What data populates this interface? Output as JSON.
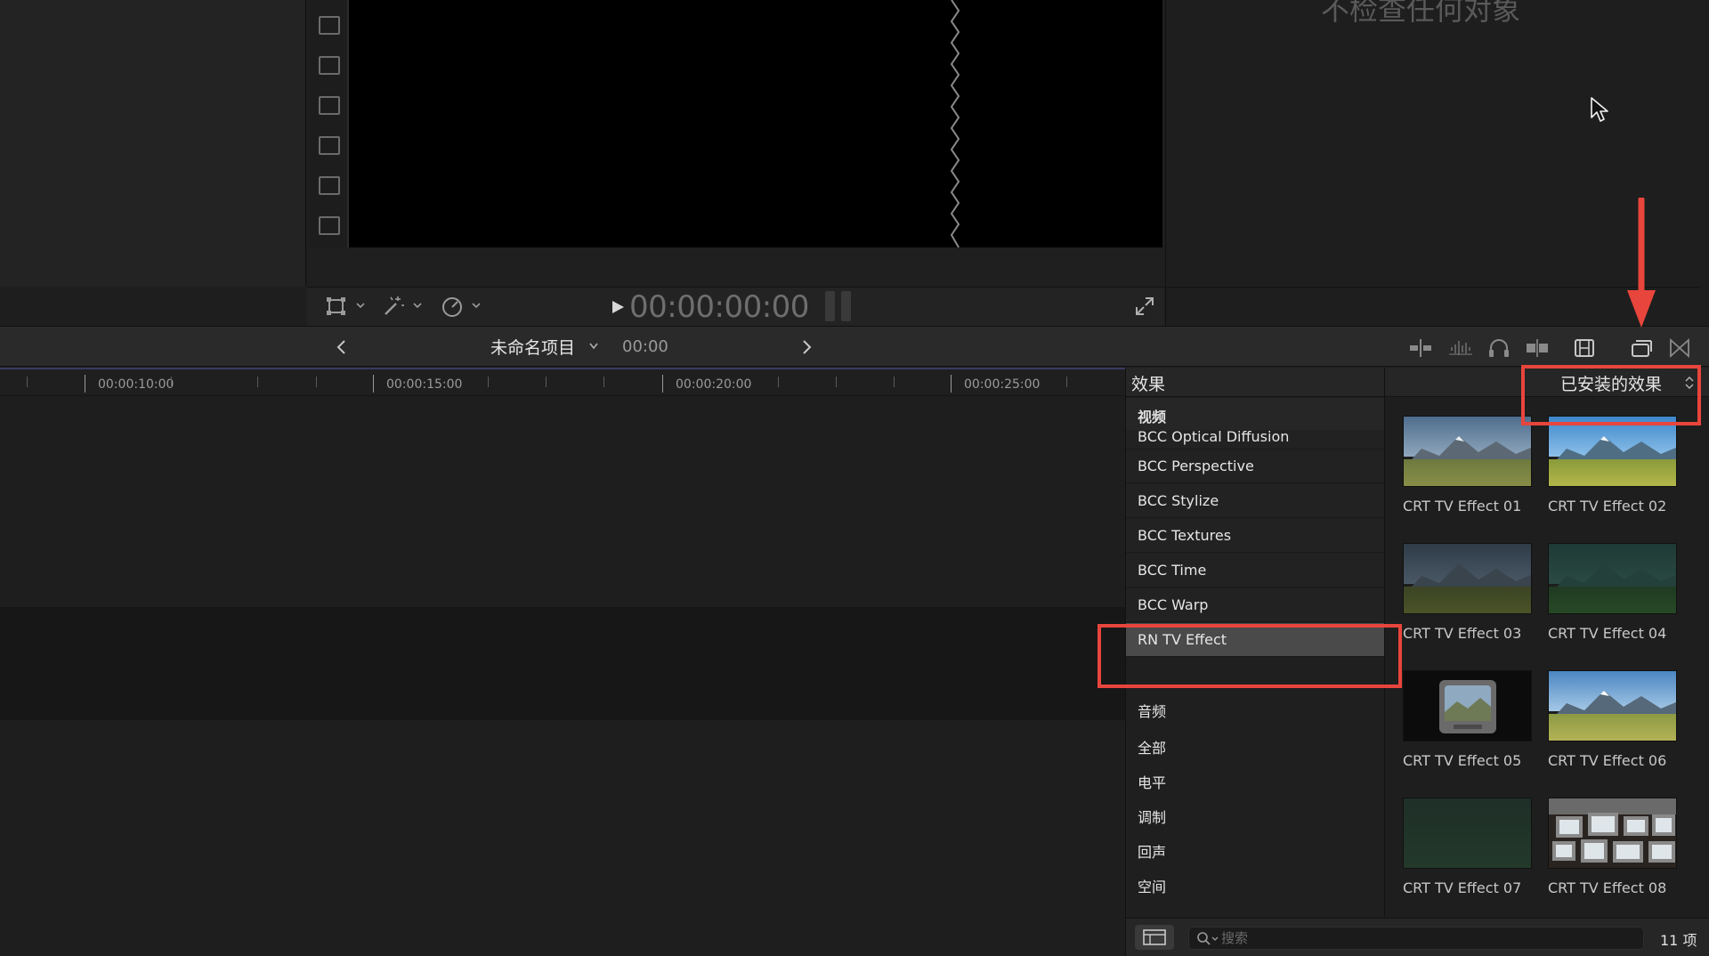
{
  "viewer": {
    "timecode": "00:00:00:00"
  },
  "inspector": {
    "message": "不检查任何对象"
  },
  "timeline_toolbar": {
    "project_name": "未命名项目",
    "timecode": "00:00"
  },
  "timeline_ruler": {
    "labels": [
      "00:00:10:00",
      "00:00:15:00",
      "00:00:20:00",
      "00:00:25:00"
    ]
  },
  "effects_browser": {
    "title": "效果",
    "filter": "已安装的效果",
    "sidebar": {
      "video_header": "视频",
      "video_items": [
        "BCC Optical Diffusion",
        "BCC Perspective",
        "BCC Stylize",
        "BCC Textures",
        "BCC Time",
        "BCC Warp",
        "RN TV Effect"
      ],
      "selected": "RN TV Effect",
      "audio_header": "音频",
      "audio_items": [
        "全部",
        "电平",
        "调制",
        "回声",
        "空间"
      ]
    },
    "grid": [
      {
        "label": "CRT TV Effect 01"
      },
      {
        "label": "CRT TV Effect 02"
      },
      {
        "label": "CRT TV Effect 03"
      },
      {
        "label": "CRT TV Effect 04"
      },
      {
        "label": "CRT TV Effect 05"
      },
      {
        "label": "CRT TV Effect 06"
      },
      {
        "label": "CRT TV Effect 07"
      },
      {
        "label": "CRT TV Effect 08"
      }
    ],
    "search_placeholder": "搜索",
    "item_count": "11 项"
  },
  "colors": {
    "annotation": "#e8453c",
    "selection": "#4a4a4a",
    "ruler_accent": "#3a3a63"
  }
}
